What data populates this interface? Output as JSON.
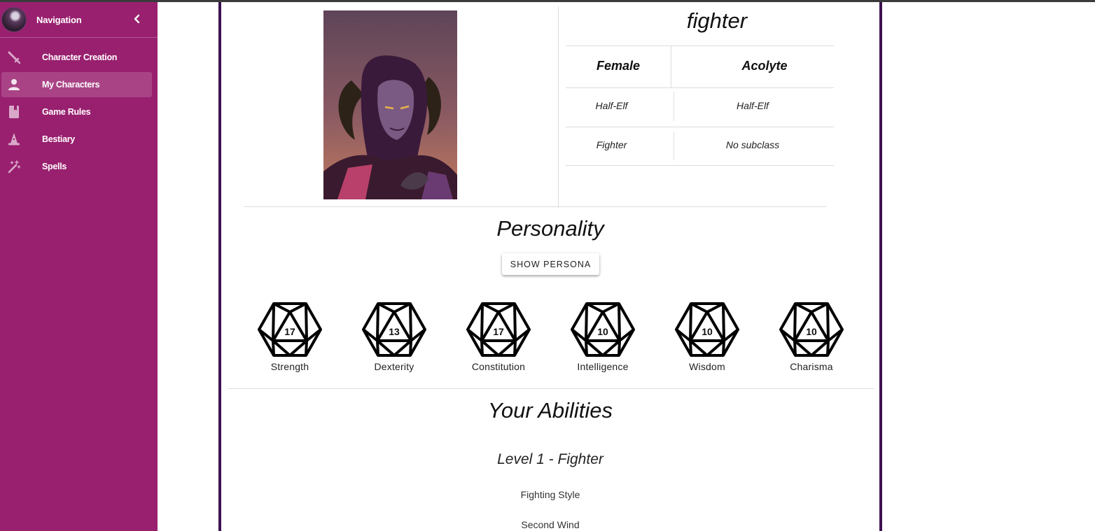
{
  "sidebar": {
    "title": "Navigation",
    "items": [
      {
        "label": "Character Creation",
        "icon": "sword-icon",
        "active": false
      },
      {
        "label": "My Characters",
        "icon": "person-icon",
        "active": true
      },
      {
        "label": "Game Rules",
        "icon": "book-icon",
        "active": false
      },
      {
        "label": "Bestiary",
        "icon": "wizard-hat-icon",
        "active": false
      },
      {
        "label": "Spells",
        "icon": "magic-wand-icon",
        "active": false
      }
    ]
  },
  "character": {
    "name": "fighter",
    "gender": "Female",
    "background": "Acolyte",
    "race": "Half-Elf",
    "subrace": "Half-Elf",
    "class": "Fighter",
    "subclass": "No subclass"
  },
  "personality": {
    "title": "Personality",
    "button_label": "SHOW PERSONA"
  },
  "stats": [
    {
      "label": "Strength",
      "value": "17"
    },
    {
      "label": "Dexterity",
      "value": "13"
    },
    {
      "label": "Constitution",
      "value": "17"
    },
    {
      "label": "Intelligence",
      "value": "10"
    },
    {
      "label": "Wisdom",
      "value": "10"
    },
    {
      "label": "Charisma",
      "value": "10"
    }
  ],
  "abilities": {
    "title": "Your Abilities",
    "level_heading": "Level 1 - Fighter",
    "items": [
      "Fighting Style",
      "Second Wind"
    ]
  },
  "colors": {
    "sidebar_bg": "#99206f",
    "frame_border": "#3d1250"
  }
}
